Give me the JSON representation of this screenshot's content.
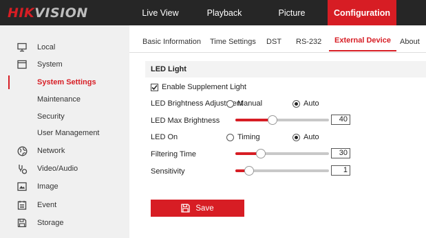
{
  "brand": {
    "logo_red": "HIK",
    "logo_gray": "VISION"
  },
  "topnav": [
    {
      "label": "Live View"
    },
    {
      "label": "Playback"
    },
    {
      "label": "Picture"
    },
    {
      "label": "Configuration",
      "active": true
    }
  ],
  "sidebar": {
    "items": [
      {
        "label": "Local",
        "icon": "monitor-icon"
      },
      {
        "label": "System",
        "icon": "window-icon"
      },
      {
        "label": "System Settings",
        "active": true
      },
      {
        "label": "Maintenance"
      },
      {
        "label": "Security"
      },
      {
        "label": "User Management"
      },
      {
        "label": "Network",
        "icon": "globe-icon"
      },
      {
        "label": "Video/Audio",
        "icon": "video-audio-icon"
      },
      {
        "label": "Image",
        "icon": "image-icon"
      },
      {
        "label": "Event",
        "icon": "event-icon"
      },
      {
        "label": "Storage",
        "icon": "storage-icon"
      }
    ]
  },
  "tabs": [
    {
      "label": "Basic Information"
    },
    {
      "label": "Time Settings"
    },
    {
      "label": "DST"
    },
    {
      "label": "RS-232"
    },
    {
      "label": "External Device",
      "active": true
    },
    {
      "label": "About"
    }
  ],
  "led": {
    "section_title": "LED Light",
    "enable_label": "Enable Supplement Light",
    "enable_checked": true,
    "brightness_adjustment": {
      "label": "LED Brightness Adjustment",
      "options": [
        "Manual",
        "Auto"
      ],
      "selected": "Auto"
    },
    "max_brightness": {
      "label": "LED Max Brightness",
      "value": "40",
      "level": 0.4
    },
    "led_on": {
      "label": "LED On",
      "options": [
        "Timing",
        "Auto"
      ],
      "selected": "Auto"
    },
    "filtering_time": {
      "label": "Filtering Time",
      "value": "30",
      "level": 0.27
    },
    "sensitivity": {
      "label": "Sensitivity",
      "value": "1",
      "level": 0.15
    }
  },
  "save_label": "Save",
  "colors": {
    "accent": "#d71d24",
    "topbar": "#262626",
    "sidebar": "#f0f0f0"
  }
}
